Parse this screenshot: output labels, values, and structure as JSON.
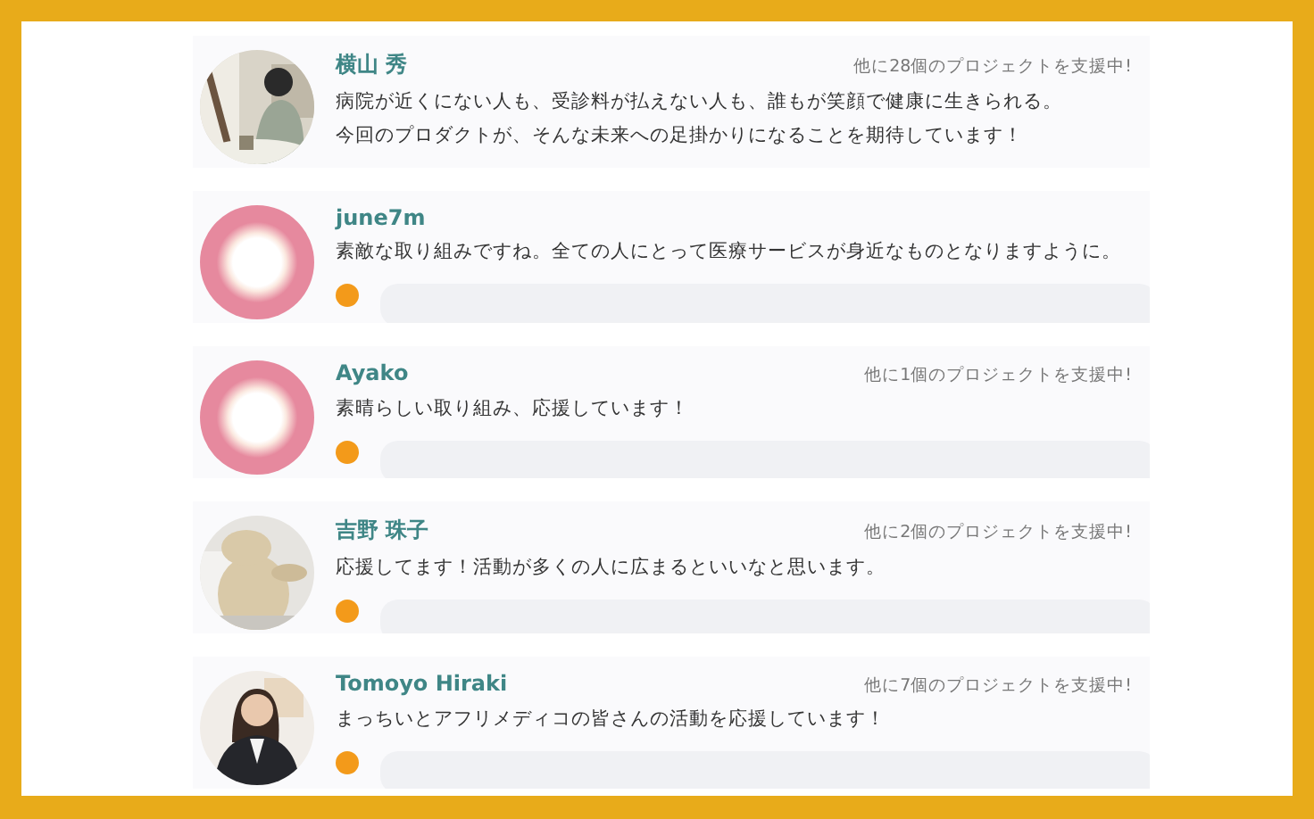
{
  "comments": [
    {
      "name": "横山 秀",
      "count": "他に28個のプロジェクトを支援中!",
      "text": [
        "病院が近くにない人も、受診料が払えない人も、誰もが笑顔で健康に生きられる。",
        "今回のプロダクトが、そんな未来への足掛かりになることを期待しています！"
      ],
      "reply": false
    },
    {
      "name": "june7m",
      "kind": "default",
      "text": [
        "素敵な取り組みですね。全ての人にとって医療サービスが身近なものとなりますように。"
      ],
      "reply": true
    },
    {
      "name": "Ayako",
      "kind": "default",
      "count": "他に1個のプロジェクトを支援中!",
      "text": [
        "素晴らしい取り組み、応援しています！"
      ],
      "reply": true
    },
    {
      "name": "吉野 珠子",
      "count": "他に2個のプロジェクトを支援中!",
      "text": [
        "応援してます！活動が多くの人に広まるといいなと思います。"
      ],
      "reply": true
    },
    {
      "name": "Tomoyo Hiraki",
      "count": "他に7個のプロジェクトを支援中!",
      "text": [
        "まっちいとアフリメディコの皆さんの活動を応援しています！"
      ],
      "reply": true
    }
  ]
}
